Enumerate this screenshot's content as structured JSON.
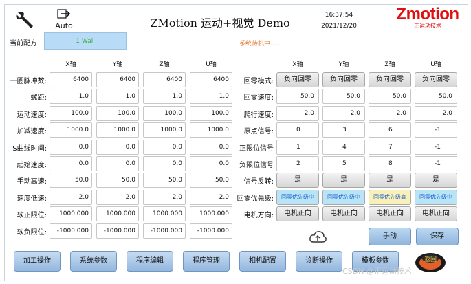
{
  "header": {
    "title": "ZMotion 运动+视觉 Demo",
    "time": "16:37:54",
    "date": "2021/12/20",
    "logo_brand": "Zmotion",
    "logo_sub": "正运动技术",
    "auto_label": "Auto",
    "recipe_label": "当前配方",
    "recipe_value": "1 Wall",
    "status_text": "系统待机中......"
  },
  "left_table": {
    "columns": [
      "X轴",
      "Y轴",
      "Z轴",
      "U轴"
    ],
    "rows": [
      {
        "label": "一圈脉冲数:",
        "values": [
          "6400",
          "6400",
          "6400",
          "6400"
        ]
      },
      {
        "label": "螺距:",
        "values": [
          "1.0",
          "1.0",
          "1.0",
          "1.0"
        ]
      },
      {
        "label": "运动速度:",
        "values": [
          "100.0",
          "100.0",
          "100.0",
          "100.0"
        ]
      },
      {
        "label": "加减速度:",
        "values": [
          "1000.0",
          "1000.0",
          "1000.0",
          "1000.0"
        ]
      },
      {
        "label": "S曲线时间:",
        "values": [
          "0.0",
          "0.0",
          "0.0",
          "0.0"
        ]
      },
      {
        "label": "起始速度:",
        "values": [
          "0.0",
          "0.0",
          "0.0",
          "0.0"
        ]
      },
      {
        "label": "手动高速:",
        "values": [
          "50.0",
          "50.0",
          "50.0",
          "50.0"
        ]
      },
      {
        "label": "速度低速:",
        "values": [
          "2.0",
          "2.0",
          "2.0",
          "2.0"
        ]
      },
      {
        "label": "软正限位:",
        "values": [
          "1000.000",
          "1000.000",
          "1000.000",
          "1000.000"
        ]
      },
      {
        "label": "软负限位:",
        "values": [
          "-1000.000",
          "-1000.000",
          "-1000.000",
          "-1000.000"
        ]
      }
    ]
  },
  "right_table": {
    "columns": [
      "X轴",
      "Y轴",
      "Z轴",
      "U轴"
    ],
    "rows": [
      {
        "label": "回零模式:",
        "kind": "button",
        "values": [
          "负向回零",
          "负向回零",
          "负向回零",
          "负向回零"
        ]
      },
      {
        "label": "回零速度:",
        "kind": "right",
        "values": [
          "50.0",
          "50.0",
          "50.0",
          "50.0"
        ]
      },
      {
        "label": "爬行速度:",
        "kind": "right",
        "values": [
          "2.0",
          "2.0",
          "2.0",
          "2.0"
        ]
      },
      {
        "label": "原点信号:",
        "kind": "center",
        "values": [
          "0",
          "3",
          "6",
          "-1"
        ]
      },
      {
        "label": "正限位信号",
        "kind": "center",
        "values": [
          "1",
          "4",
          "7",
          "-1"
        ]
      },
      {
        "label": "负限位信号",
        "kind": "center",
        "values": [
          "2",
          "5",
          "8",
          "-1"
        ]
      },
      {
        "label": "信号反转:",
        "kind": "button",
        "values": [
          "是",
          "是",
          "是",
          "是"
        ]
      },
      {
        "label": "回零优先级:",
        "kind": "prio",
        "values": [
          "回零优先级中",
          "回零优先级中",
          "回零优先级高",
          "回零优先级中"
        ]
      },
      {
        "label": "电机方向:",
        "kind": "button",
        "values": [
          "电机正向",
          "电机正向",
          "电机正向",
          "电机正向"
        ]
      }
    ]
  },
  "actions": {
    "manual": "手动",
    "save": "保存"
  },
  "nav": [
    "加工操作",
    "系统参数",
    "程序编辑",
    "程序管理",
    "相机配置",
    "诊断操作",
    "模板参数"
  ],
  "badge_text": "返回",
  "watermark": "CSDN @正运动技术",
  "colors": {
    "brand_red": "#e01010",
    "status_orange": "#e67d3a",
    "recipe_bg": "#b8dcf8",
    "prio_blue": "#b9e4f6",
    "prio_yellow": "#f8f0b8"
  }
}
